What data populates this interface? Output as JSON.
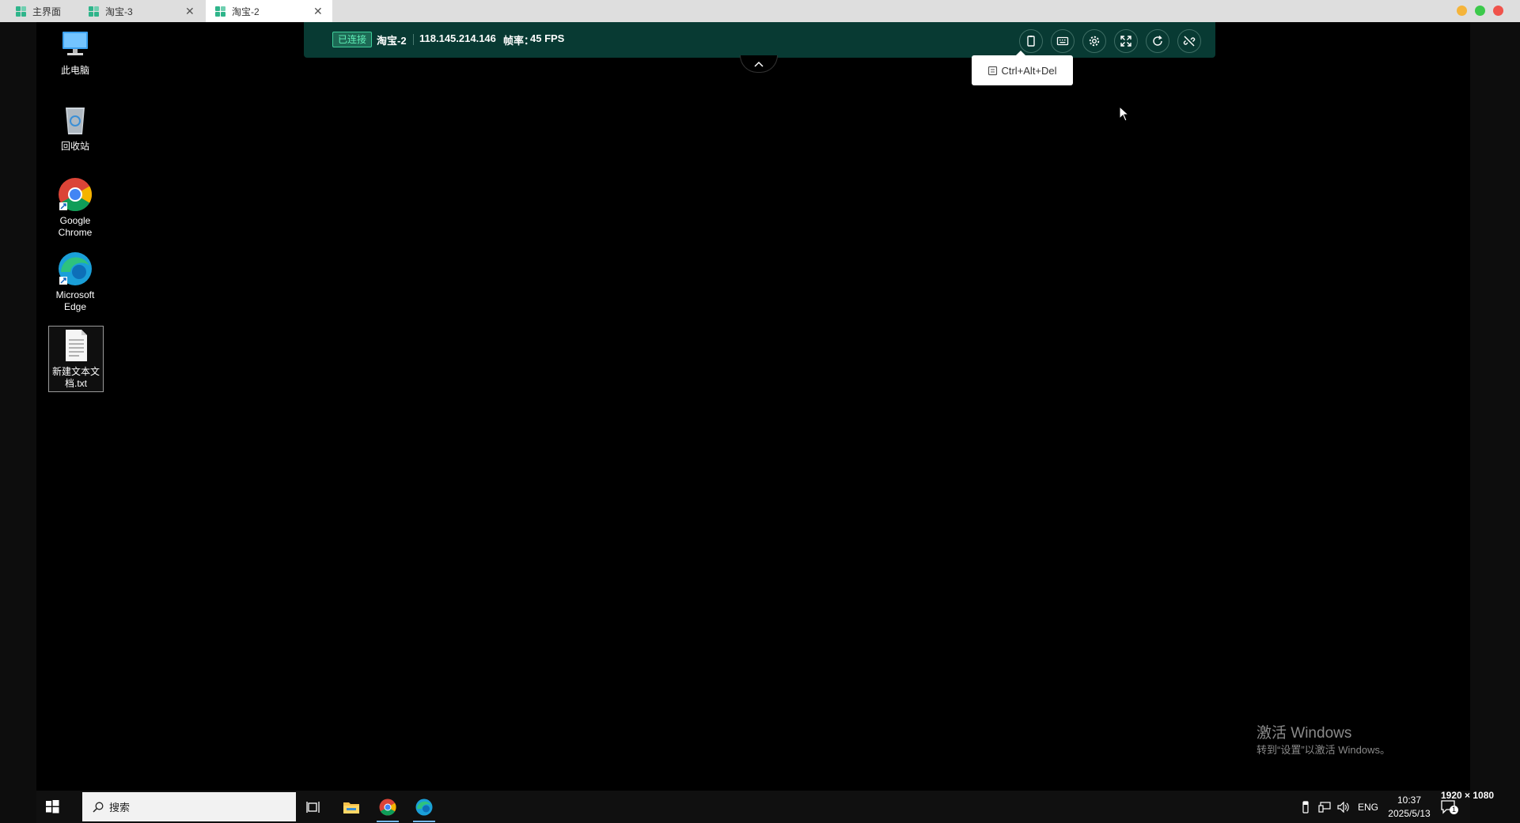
{
  "window": {
    "tabs": [
      {
        "label": "主界面",
        "closable": false,
        "active": false
      },
      {
        "label": "淘宝-3",
        "closable": true,
        "active": false
      },
      {
        "label": "淘宝-2",
        "closable": true,
        "active": true
      }
    ],
    "close_glyph": "✕",
    "controls": {
      "minimize_color": "#f5b43a",
      "maximize_color": "#3cc94b",
      "close_color": "#f0534b"
    }
  },
  "remote_bar": {
    "status": "已连接",
    "host_name": "淘宝-2",
    "ip": "118.145.214.146",
    "fps_label": "帧率：",
    "fps_value": "45 FPS",
    "buttons": [
      "clipboard-icon",
      "keyboard-icon",
      "settings-icon",
      "fullscreen-icon",
      "refresh-icon",
      "disconnect-icon"
    ],
    "collapse_icon": "chevron-up-icon",
    "tooltip": "Ctrl+Alt+Del",
    "accent": "#083a33"
  },
  "desktop": {
    "icons": [
      {
        "label": "此电脑",
        "icon": "computer-icon"
      },
      {
        "label": "回收站",
        "icon": "recycle-bin-icon"
      },
      {
        "label": "Google Chrome",
        "icon": "chrome-icon"
      },
      {
        "label": "Microsoft Edge",
        "icon": "edge-icon"
      },
      {
        "label": "新建文本文档.txt",
        "icon": "text-file-icon"
      }
    ]
  },
  "watermark": {
    "title": "激活 Windows",
    "subtitle": "转到“设置”以激活 Windows。"
  },
  "taskbar": {
    "search_placeholder": "搜索",
    "pinned": [
      "task-view-icon",
      "file-explorer-icon",
      "chrome-icon",
      "edge-icon"
    ],
    "tray_lang": "ENG",
    "time": "10:37",
    "date": "2025/5/13",
    "notification_count": "1"
  },
  "resolution_label": "1920 × 1080"
}
